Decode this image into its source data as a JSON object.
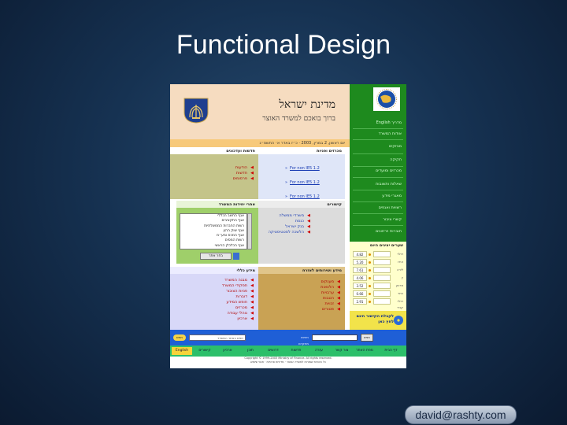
{
  "slide": {
    "title": "Functional Design",
    "footer_badge": "david@rashty.com"
  },
  "site": {
    "name": "מדינת ישראל",
    "subtitle": "ברוך בואכם למשרד האוצר",
    "date_line": "יום ראשון, 2 במרץ, 2003 · כ״ז באדר א׳ התשס״ג",
    "nav": [
      "מדריך English",
      "אודות המשרד",
      "מבזקים",
      "חקיקה",
      "מכרזים ומועדים",
      "שאלות ותשובות",
      "מאגרי מידע",
      "רשויות ואגפים",
      "קשרי ציבור",
      "חוברות וירחונים",
      "תקציב המדינה"
    ],
    "news_panel": {
      "title": "חדשות ועדכונים",
      "links": [
        "הודעות",
        "חדשות",
        "פרסומים"
      ]
    },
    "tenders_panel": {
      "title": "מכרזים ופניות",
      "links": [
        "For non IE5 1.2",
        "For non IE5 1.2",
        "For non IE5 1.2"
      ]
    },
    "units_panel": {
      "title": "אתרי יחידות המשרד",
      "options": [
        "אגף החשב הכללי",
        "אגף התקציבים",
        "רשות החברות הממשלתיות",
        "אגף שוק ההון",
        "אגף המכס ומע״מ",
        "רשות המסים",
        "אגף הכלכלן הראשי"
      ],
      "button": "בחר אתר"
    },
    "links_panel": {
      "title": "קישורים",
      "links": [
        "משרדי ממשלה",
        "כנסת",
        "בנק ישראל",
        "הלשכה לסטטיסטיקה"
      ]
    },
    "general_panel": {
      "title": "מידע כללי",
      "links": [
        "מבנה המשרד",
        "תפקידי המשרד",
        "פניות הציבור",
        "דוברות",
        "חופש המידע",
        "מכרזים",
        "נוהלי עבודה",
        "ארכיון"
      ]
    },
    "services_panel": {
      "title": "מידע ושירותים לאזרח",
      "links": [
        "מענקים",
        "הלוואות",
        "ערבויות",
        "הטבות",
        "זכויות",
        "פטורים"
      ]
    },
    "rates_panel": {
      "title": "שערים יציגים היום",
      "rows": [
        {
          "value": "4.82",
          "name": "דולר"
        },
        {
          "value": "5.20",
          "name": "אירו"
        },
        {
          "value": "7.61",
          "name": "לירה"
        },
        {
          "value": "4.06",
          "name": "ין"
        },
        {
          "value": "3.52",
          "name": "פרנק"
        },
        {
          "value": "0.66",
          "name": "כתר"
        },
        {
          "value": "2.91",
          "name": "דולר קנדי"
        }
      ]
    },
    "promo_box": {
      "text": "לקבלת הקישור חינם לחץ כאן"
    },
    "search": {
      "placeholder": "חפש באתר המשרד",
      "go_label": "חפש",
      "find_label": "חיפוש מתקדם"
    },
    "tabs": [
      "דף הבית",
      "מפת האתר",
      "צור קשר",
      "עזרה",
      "חדשות",
      "דרושים",
      "תוכן",
      "ארכיון",
      "קישורים",
      "English"
    ],
    "footer_lines": [
      "Copyright © 1999-2003 Ministry of Finance. All rights reserved.",
      "כל הזכויות שמורות למשרד האוצר · מדיניות פרטיות · תנאי שימוש"
    ]
  }
}
